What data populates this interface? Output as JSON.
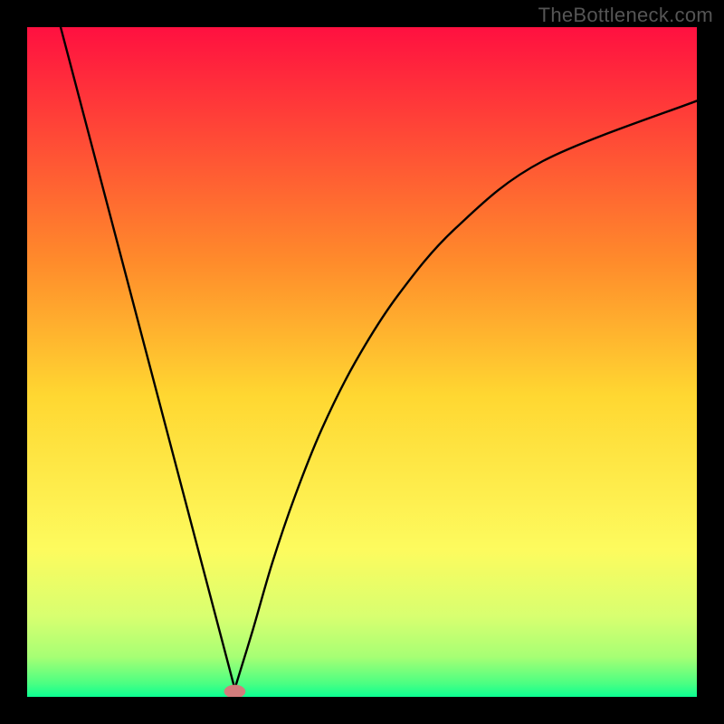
{
  "watermark": "TheBottleneck.com",
  "chart_data": {
    "type": "line",
    "title": "",
    "xlabel": "",
    "ylabel": "",
    "xlim": [
      0,
      100
    ],
    "ylim": [
      0,
      100
    ],
    "grid": false,
    "legend": false,
    "background_gradient": {
      "stops": [
        {
          "offset": 0.0,
          "color": "#ff1040"
        },
        {
          "offset": 0.35,
          "color": "#ff8b2b"
        },
        {
          "offset": 0.55,
          "color": "#ffd731"
        },
        {
          "offset": 0.78,
          "color": "#fdfb5e"
        },
        {
          "offset": 0.88,
          "color": "#d8ff70"
        },
        {
          "offset": 0.94,
          "color": "#a7ff74"
        },
        {
          "offset": 0.98,
          "color": "#4bff82"
        },
        {
          "offset": 1.0,
          "color": "#0cff92"
        }
      ]
    },
    "curve": {
      "minimum_x": 31,
      "minimum_y": 0,
      "comment": "V-shaped curve with near-linear left branch from top-left to min at ~31%, and convex right branch rising toward ~90% at right edge.",
      "left_branch": [
        {
          "x": 5.0,
          "y": 100.0
        },
        {
          "x": 31.0,
          "y": 1.2
        }
      ],
      "right_branch": [
        {
          "x": 31.0,
          "y": 1.2
        },
        {
          "x": 33.7,
          "y": 10.0
        },
        {
          "x": 36.6,
          "y": 20.0
        },
        {
          "x": 40.0,
          "y": 30.0
        },
        {
          "x": 44.0,
          "y": 40.0
        },
        {
          "x": 49.0,
          "y": 50.0
        },
        {
          "x": 55.4,
          "y": 60.0
        },
        {
          "x": 64.0,
          "y": 70.0
        },
        {
          "x": 77.0,
          "y": 80.0
        },
        {
          "x": 100.0,
          "y": 89.0
        }
      ]
    },
    "marker": {
      "x": 31,
      "y": 0.8,
      "color": "#d37c7c",
      "rx": 1.6,
      "ry": 1.0
    }
  }
}
